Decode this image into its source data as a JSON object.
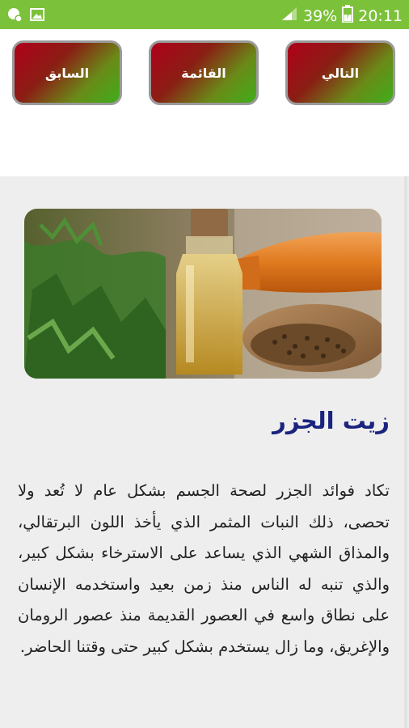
{
  "status_bar": {
    "battery": "39%",
    "time": "20:11",
    "icons": [
      "messaging-icon",
      "image-icon",
      "signal-icon",
      "battery-charging-icon"
    ],
    "color": "#7cc13a"
  },
  "nav": {
    "next_label": "التالي",
    "list_label": "القائمة",
    "previous_label": "السابق"
  },
  "article": {
    "title": "زيت الجزر",
    "body": "تكاد فوائد الجزر لصحة الجسم بشكل عام لا تُعد ولا تحصى، ذلك النبات المثمر الذي يأخذ اللون البرتقالي، والمذاق الشهي الذي يساعد على الاسترخاء بشكل كبير، والذي تنبه له الناس منذ زمن بعيد واستخدمه الإنسان على نطاق واسع في العصور القديمة منذ عصور الرومان والإغريق، وما زال يستخدم بشكل كبير حتى وقتنا الحاضر.",
    "title_color": "#1a237e"
  }
}
